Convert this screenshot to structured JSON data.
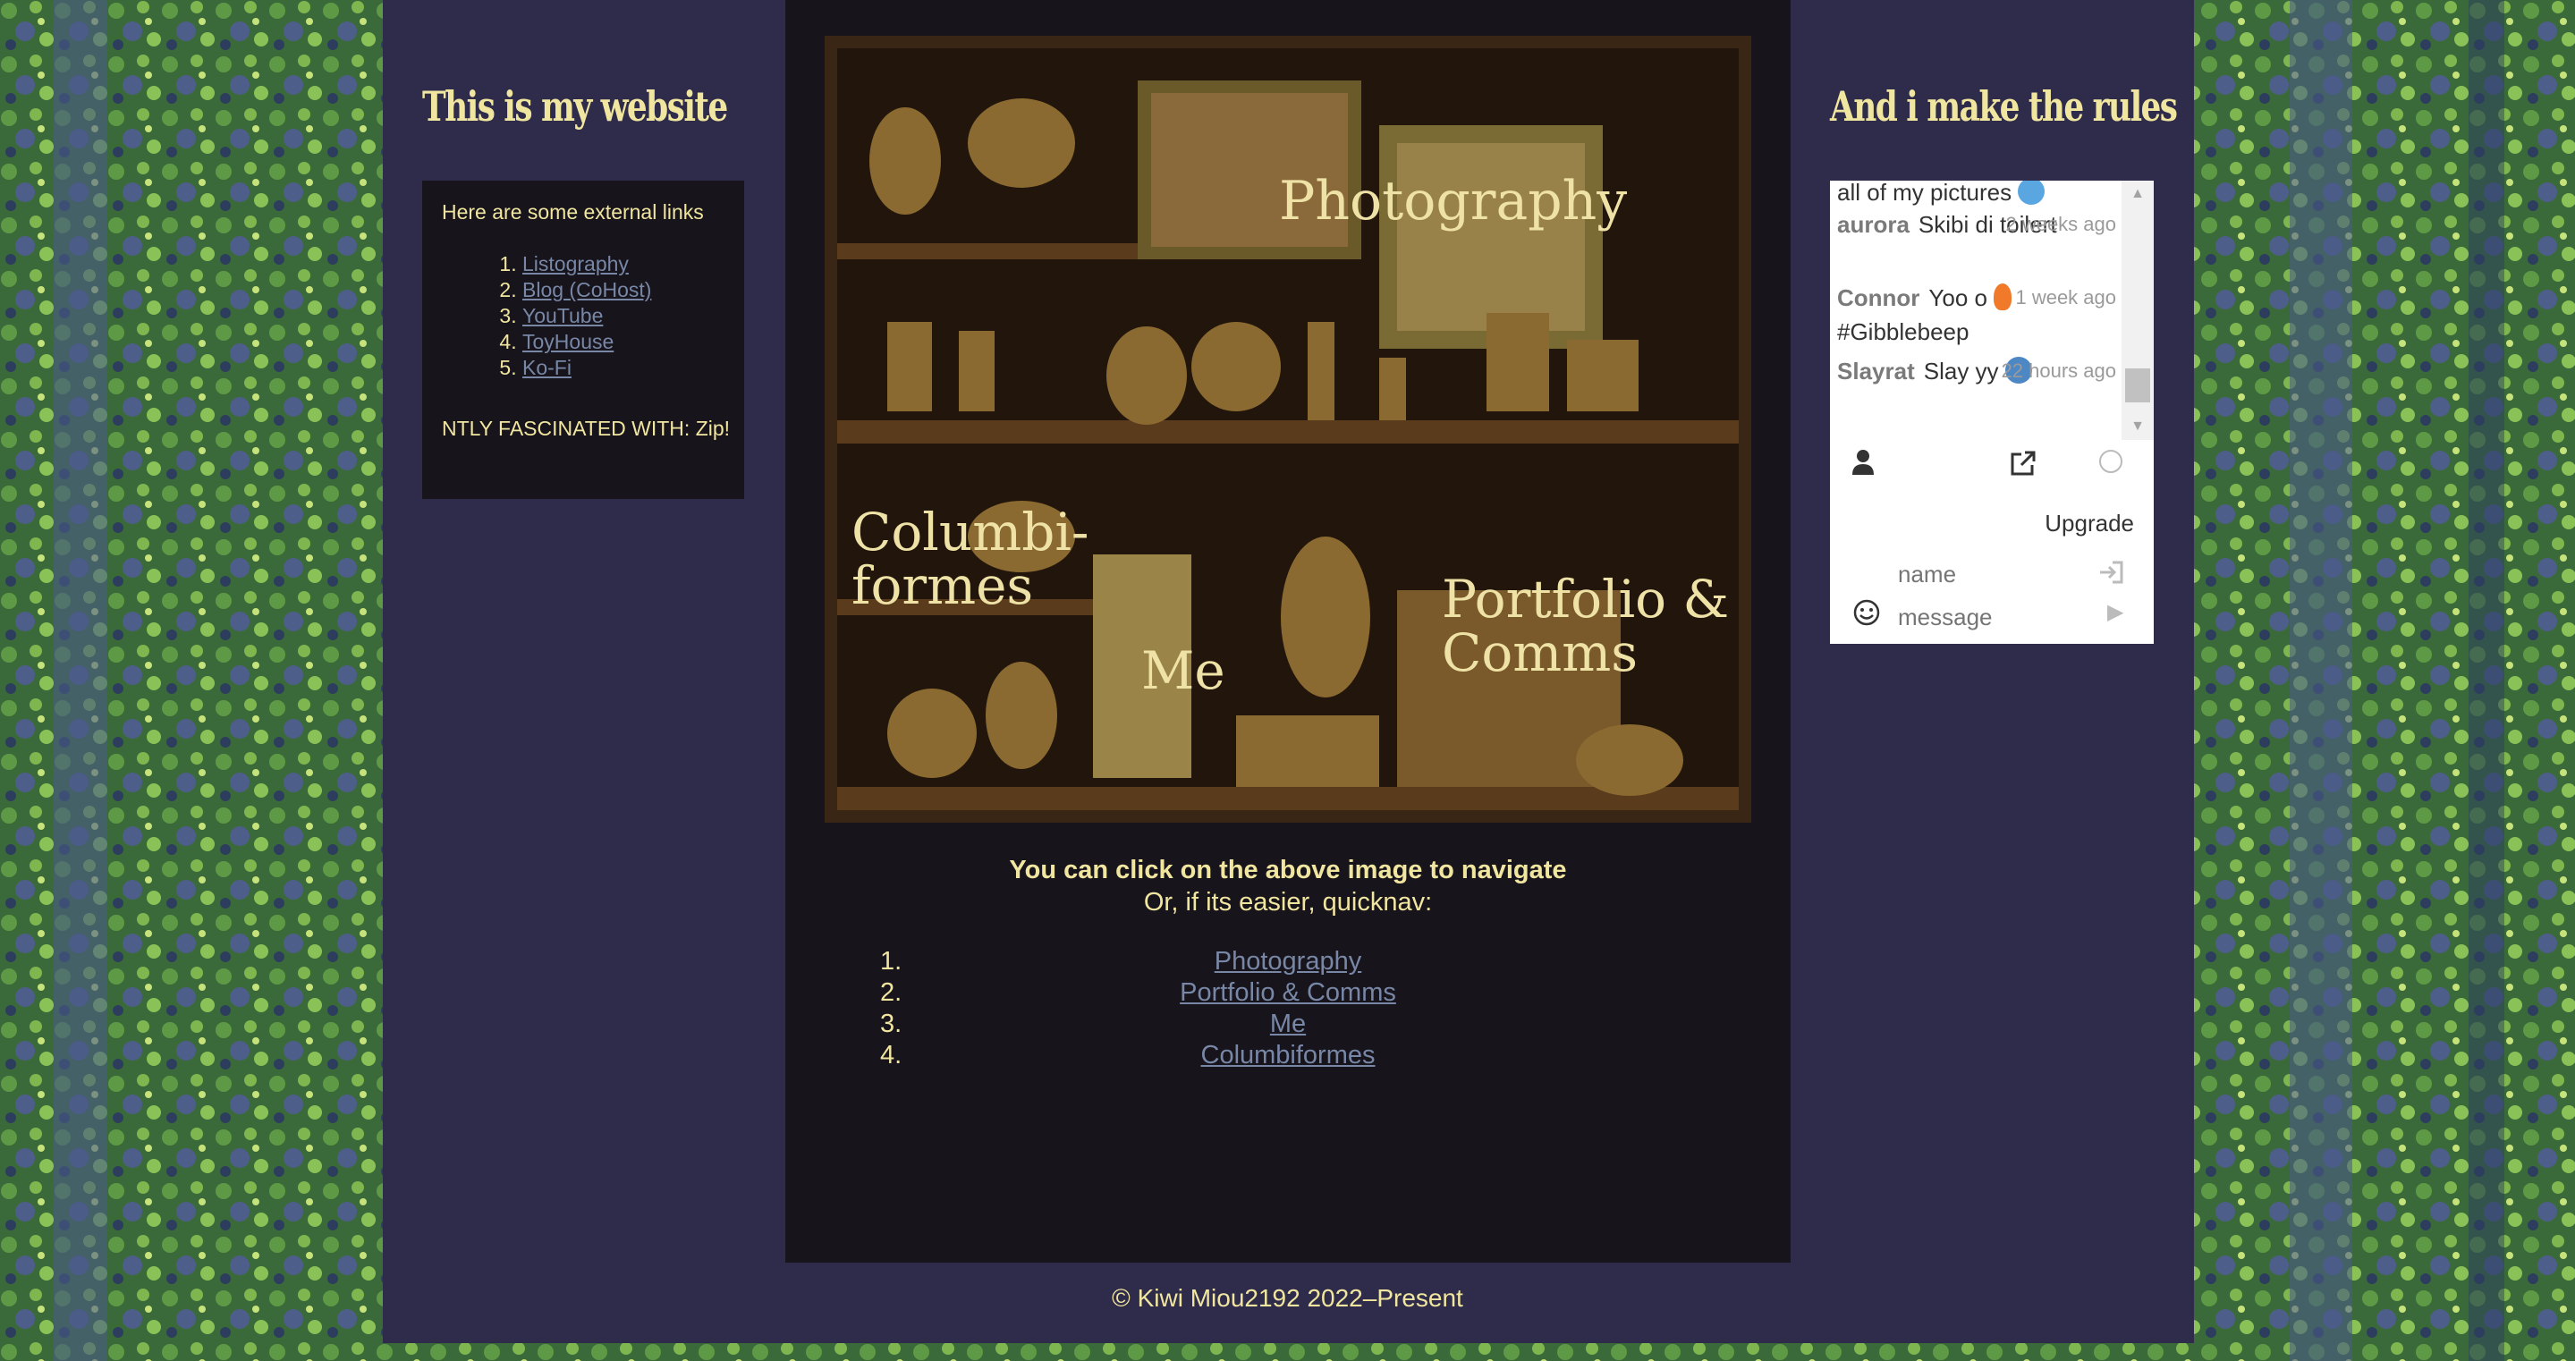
{
  "left": {
    "title": "This is my website",
    "links_heading": "Here are some external links",
    "links": [
      "Listography",
      "Blog (CoHost)",
      "YouTube",
      "ToyHouse",
      "Ko-Fi"
    ],
    "marquee": "NTLY FASCINATED WITH: Zip!"
  },
  "right": {
    "title": "And i make the rules"
  },
  "center": {
    "image_labels": {
      "photography": "Photography",
      "columbiformes_1": "Columbi-",
      "columbiformes_2": "formes",
      "me": "Me",
      "portfolio_1": "Portfolio &",
      "portfolio_2": "Comms"
    },
    "nav_line1": "You can click on the above image to navigate",
    "nav_line2": "Or, if its easier, quicknav:",
    "quicknav": [
      {
        "num": "1.",
        "label": "Photography"
      },
      {
        "num": "2.",
        "label": "Portfolio & Comms"
      },
      {
        "num": "3.",
        "label": "Me"
      },
      {
        "num": "4.",
        "label": "Columbiformes"
      }
    ]
  },
  "footer": "© Kiwi Miou2192 2022–Present",
  "chatbox": {
    "messages": [
      {
        "name": "",
        "text": "all of my pictures",
        "time": ""
      },
      {
        "name": "aurora",
        "text": "Skibi di toilert",
        "time": "2 weeks ago"
      },
      {
        "name": "Connor",
        "text": "Yoo o",
        "text2": "#Gibblebeep",
        "time": "1 week ago"
      },
      {
        "name": "Slayrat",
        "text": "Slay yy",
        "time": "22 hours ago"
      }
    ],
    "upgrade": "Upgrade",
    "name_placeholder": "name",
    "message_placeholder": "message"
  },
  "colors": {
    "accent_text": "#f1e6a0",
    "link": "#7887a6",
    "page_bg": "#2e2c4a",
    "panel_bg": "#17141c"
  }
}
